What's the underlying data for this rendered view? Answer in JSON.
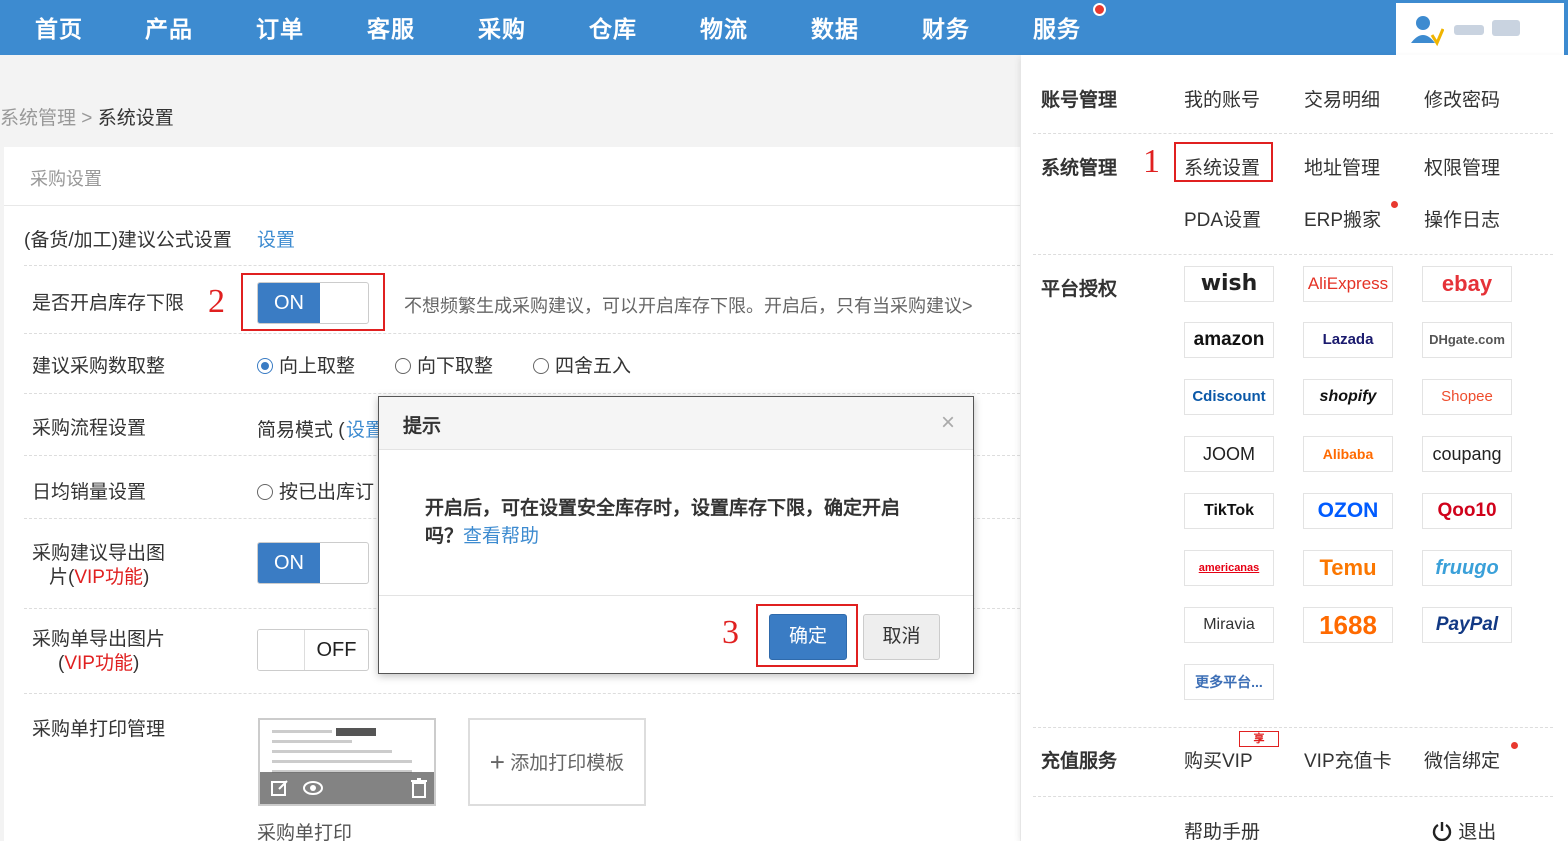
{
  "nav": {
    "items": [
      "首页",
      "产品",
      "订单",
      "客服",
      "采购",
      "仓库",
      "物流",
      "数据",
      "财务",
      "服务"
    ]
  },
  "breadcrumb": {
    "parent": "系统管理",
    "sep": ">",
    "current": "系统设置"
  },
  "panel": {
    "title": "采购设置",
    "rows": {
      "formula": {
        "label": "(备货/加工)建议公式设置",
        "link": "设置"
      },
      "stock_limit": {
        "label": "是否开启库存下限",
        "toggle": "ON",
        "desc": "不想频繁生成采购建议，可以开启库存下限。开启后，只有当采购建议>"
      },
      "rounding": {
        "label": "建议采购数取整",
        "options": [
          "向上取整",
          "向下取整",
          "四舍五入"
        ],
        "selected": "向上取整"
      },
      "flow": {
        "label": "采购流程设置",
        "value": "简易模式 (",
        "link": "设置"
      },
      "daily_sales": {
        "label": "日均销量设置",
        "option": "按已出库订"
      },
      "export_suggest": {
        "label_1": "采购建议导出图",
        "label_2": "片(",
        "vip": "VIP功能",
        "label_3": ")",
        "toggle": "ON"
      },
      "export_order": {
        "label_1": "采购单导出图片",
        "label_2": "(",
        "vip": "VIP功能",
        "label_3": ")",
        "toggle": "OFF"
      },
      "print": {
        "label": "采购单打印管理",
        "add_template": "添加打印模板",
        "thumb_caption": "采购单打印"
      }
    }
  },
  "annotations": {
    "a1": "1",
    "a2": "2",
    "a3": "3"
  },
  "modal": {
    "title": "提示",
    "close": "×",
    "body": "开启后，可在设置安全库存时，设置库存下限，确定开启吗？",
    "help_link": "查看帮助",
    "ok": "确定",
    "cancel": "取消"
  },
  "dropdown": {
    "account": {
      "head": "账号管理",
      "items": [
        "我的账号",
        "交易明细",
        "修改密码"
      ]
    },
    "system": {
      "head": "系统管理",
      "items": [
        "系统设置",
        "地址管理",
        "权限管理",
        "PDA设置",
        "ERP搬家",
        "操作日志"
      ]
    },
    "platform": {
      "head": "平台授权",
      "logos": [
        "wish",
        "AliExpress",
        "ebay",
        "amazon",
        "Lazada",
        "DHgate.com",
        "Cdiscount",
        "shopify",
        "Shopee",
        "JOOM",
        "Alibaba",
        "coupang",
        "TikTok",
        "OZON",
        "Qoo10",
        "americanas",
        "Temu",
        "fruugo",
        "Miravia",
        "1688",
        "PayPal",
        "更多平台..."
      ]
    },
    "recharge": {
      "head": "充值服务",
      "items": [
        "购买VIP",
        "VIP充值卡",
        "微信绑定"
      ],
      "badge": "享"
    },
    "footer": {
      "help": "帮助手册",
      "logout": "退出"
    }
  },
  "colors": {
    "nav_bg": "#3d8bd0",
    "primary": "#3a7cc4",
    "annotation": "#e02020"
  }
}
